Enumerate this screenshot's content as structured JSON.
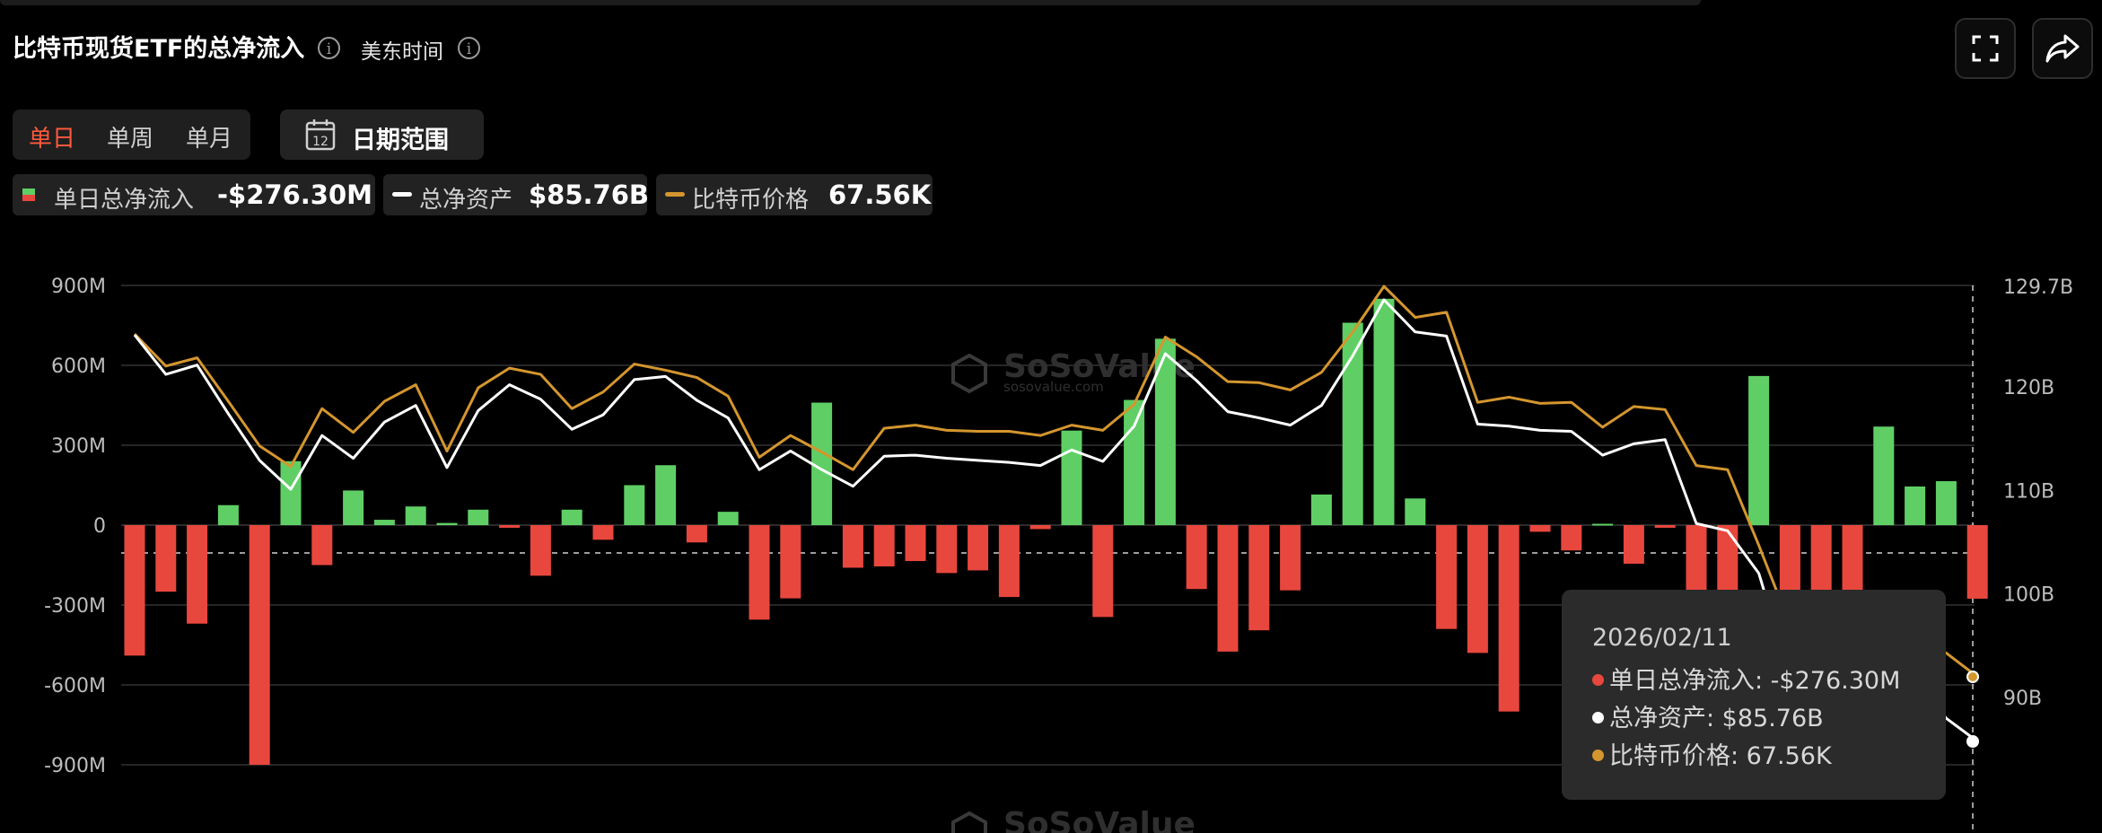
{
  "header": {
    "title": "比特币现货ETF的总净流入",
    "timezone": "美东时间"
  },
  "tabs": [
    {
      "label": "单日",
      "active": true
    },
    {
      "label": "单周",
      "active": false
    },
    {
      "label": "单月",
      "active": false
    }
  ],
  "date_range": {
    "label": "日期范围",
    "icon_text": "12"
  },
  "legend": {
    "inflow_label": "单日总净流入",
    "inflow_value": "-$276.30M",
    "assets_label": "总净资产",
    "assets_value": "$85.76B",
    "price_label": "比特币价格",
    "price_value": "67.56K"
  },
  "tooltip": {
    "date": "2026/02/11",
    "inflow": "单日总净流入: -$276.30M",
    "assets": "总净资产: $85.76B",
    "price": "比特币价格: 67.56K"
  },
  "watermark": {
    "brand": "SoSoValue",
    "url": "sosovalue.com"
  },
  "colors": {
    "positive": "#5fcf65",
    "negative": "#e8473e",
    "assets_line": "#ffffff",
    "price_line": "#d4962e",
    "accent": "#ff5a3c"
  },
  "chart_data": {
    "type": "bar",
    "left_axis": {
      "ticks": [
        "900M",
        "600M",
        "300M",
        "0",
        "-300M",
        "-600M",
        "-900M"
      ],
      "ylim": [
        -1000,
        1000
      ],
      "unit": "M"
    },
    "right_axis": {
      "ticks": [
        "129.7B",
        "120B",
        "110B",
        "100B",
        "90B"
      ]
    },
    "bars": {
      "name": "单日总净流入",
      "values": [
        -490,
        -250,
        -370,
        75,
        -900,
        240,
        -150,
        130,
        20,
        70,
        8,
        58,
        -10,
        -190,
        58,
        -55,
        150,
        225,
        -65,
        50,
        -355,
        -275,
        460,
        -160,
        -155,
        -135,
        -180,
        -170,
        -270,
        -15,
        355,
        -345,
        470,
        700,
        -240,
        -475,
        -395,
        -245,
        115,
        760,
        850,
        100,
        -390,
        -480,
        -700,
        -25,
        -95,
        5,
        -145,
        -10,
        -300,
        -300,
        560,
        -300,
        -300,
        -300,
        370,
        145,
        165,
        -276.3
      ]
    },
    "series": [
      {
        "name": "总净资产",
        "values": [
          125.0,
          121.2,
          122.1,
          117.4,
          112.9,
          110.1,
          115.3,
          113.1,
          116.6,
          118.2,
          112.2,
          117.7,
          120.2,
          118.8,
          115.9,
          117.3,
          120.7,
          121.0,
          118.7,
          117.0,
          112.0,
          113.8,
          112.0,
          110.4,
          113.3,
          113.4,
          113.1,
          112.9,
          112.7,
          112.4,
          113.9,
          112.8,
          116.2,
          123.2,
          120.6,
          117.6,
          117.0,
          116.3,
          118.2,
          123.0,
          128.4,
          125.3,
          124.9,
          116.4,
          116.2,
          115.8,
          115.7,
          113.4,
          114.5,
          114.9,
          106.8,
          106.1,
          102.0,
          92.0,
          88.5,
          94.5,
          90.0,
          91.8,
          88.0,
          85.76
        ]
      },
      {
        "name": "比特币价格",
        "values": [
          125.1,
          122.0,
          122.8,
          118.6,
          114.3,
          112.3,
          117.9,
          115.6,
          118.6,
          120.2,
          113.8,
          119.9,
          121.8,
          121.2,
          117.9,
          119.5,
          122.2,
          121.6,
          120.9,
          119.1,
          113.2,
          115.3,
          113.7,
          112.0,
          116.0,
          116.3,
          115.8,
          115.7,
          115.7,
          115.3,
          116.3,
          115.8,
          118.3,
          124.8,
          122.9,
          120.5,
          120.4,
          119.7,
          121.4,
          125.3,
          129.7,
          126.7,
          127.2,
          118.5,
          119.0,
          118.4,
          118.5,
          116.1,
          118.1,
          117.8,
          112.4,
          112.0,
          104.7,
          97.0,
          95.5,
          98.0,
          94.0,
          95.7,
          94.3,
          92.0
        ]
      }
    ]
  }
}
